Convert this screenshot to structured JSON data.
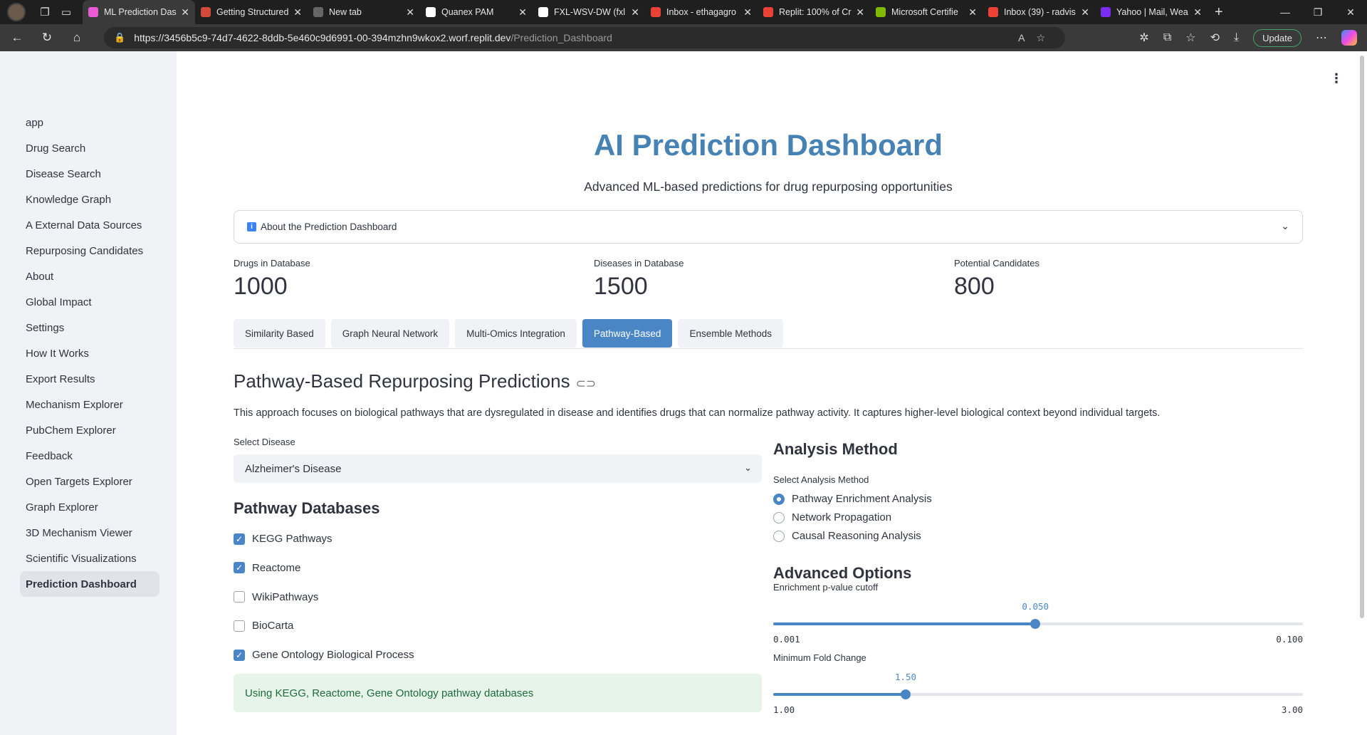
{
  "browser": {
    "tabs": [
      {
        "title": "ML Prediction Das",
        "color": "#e75bd4",
        "active": true
      },
      {
        "title": "Getting Structured",
        "color": "#d34a3b",
        "active": false
      },
      {
        "title": "New tab",
        "color": "#666666",
        "active": false
      },
      {
        "title": "Quanex PAM",
        "color": "#ffffff",
        "active": false
      },
      {
        "title": "FXL-WSV-DW (fxl",
        "color": "#ffffff",
        "active": false
      },
      {
        "title": "Inbox - ethagagro",
        "color": "#ea4335",
        "active": false
      },
      {
        "title": "Replit: 100% of Cr",
        "color": "#ea4335",
        "active": false
      },
      {
        "title": "Microsoft Certifie",
        "color": "#7fba00",
        "active": false
      },
      {
        "title": "Inbox (39) - radvis",
        "color": "#ea4335",
        "active": false
      },
      {
        "title": "Yahoo | Mail, Wea",
        "color": "#7b2cf5",
        "active": false
      }
    ],
    "url_host": "https://3456b5c9-74d7-4622-8ddb-5e460c9d6991-00-394mzhn9wkox2.worf.replit.dev",
    "url_path": "/Prediction_Dashboard",
    "update_label": "Update"
  },
  "sidebar": {
    "items": [
      {
        "label": "app",
        "active": false
      },
      {
        "label": "Drug Search",
        "active": false
      },
      {
        "label": "Disease Search",
        "active": false
      },
      {
        "label": "Knowledge Graph",
        "active": false
      },
      {
        "label": "A External Data Sources",
        "active": false
      },
      {
        "label": "Repurposing Candidates",
        "active": false
      },
      {
        "label": "About",
        "active": false
      },
      {
        "label": "Global Impact",
        "active": false
      },
      {
        "label": "Settings",
        "active": false
      },
      {
        "label": "How It Works",
        "active": false
      },
      {
        "label": "Export Results",
        "active": false
      },
      {
        "label": "Mechanism Explorer",
        "active": false
      },
      {
        "label": "PubChem Explorer",
        "active": false
      },
      {
        "label": "Feedback",
        "active": false
      },
      {
        "label": "Open Targets Explorer",
        "active": false
      },
      {
        "label": "Graph Explorer",
        "active": false
      },
      {
        "label": "3D Mechanism Viewer",
        "active": false
      },
      {
        "label": "Scientific Visualizations",
        "active": false
      },
      {
        "label": "Prediction Dashboard",
        "active": true
      }
    ]
  },
  "main": {
    "title": "AI Prediction Dashboard",
    "subtitle": "Advanced ML-based predictions for drug repurposing opportunities",
    "expander_label": "About the Prediction Dashboard",
    "metrics": [
      {
        "label": "Drugs in Database",
        "value": "1000"
      },
      {
        "label": "Diseases in Database",
        "value": "1500"
      },
      {
        "label": "Potential Candidates",
        "value": "800"
      }
    ],
    "tabs": [
      {
        "label": "Similarity Based",
        "active": false
      },
      {
        "label": "Graph Neural Network",
        "active": false
      },
      {
        "label": "Multi-Omics Integration",
        "active": false
      },
      {
        "label": "Pathway-Based",
        "active": true
      },
      {
        "label": "Ensemble Methods",
        "active": false
      }
    ],
    "section_title": "Pathway-Based Repurposing Predictions",
    "section_desc": "This approach focuses on biological pathways that are dysregulated in disease and identifies drugs that can normalize pathway activity. It captures higher-level biological context beyond individual targets.",
    "disease_select": {
      "label": "Select Disease",
      "value": "Alzheimer's Disease"
    },
    "pathway_db": {
      "heading": "Pathway Databases",
      "options": [
        {
          "label": "KEGG Pathways",
          "checked": true
        },
        {
          "label": "Reactome",
          "checked": true
        },
        {
          "label": "WikiPathways",
          "checked": false
        },
        {
          "label": "BioCarta",
          "checked": false
        },
        {
          "label": "Gene Ontology Biological Process",
          "checked": true
        }
      ],
      "status": "Using KEGG, Reactome, Gene Ontology pathway databases"
    },
    "analysis": {
      "heading": "Analysis Method",
      "label": "Select Analysis Method",
      "options": [
        {
          "label": "Pathway Enrichment Analysis",
          "selected": true
        },
        {
          "label": "Network Propagation",
          "selected": false
        },
        {
          "label": "Causal Reasoning Analysis",
          "selected": false
        }
      ]
    },
    "advanced": {
      "heading": "Advanced Options",
      "sliders": [
        {
          "label": "Enrichment p-value cutoff",
          "value": 0.05,
          "value_text": "0.050",
          "min": 0.001,
          "min_text": "0.001",
          "max": 0.1,
          "max_text": "0.100"
        },
        {
          "label": "Minimum Fold Change",
          "value": 1.5,
          "value_text": "1.50",
          "min": 1.0,
          "min_text": "1.00",
          "max": 3.0,
          "max_text": "3.00"
        }
      ]
    }
  }
}
